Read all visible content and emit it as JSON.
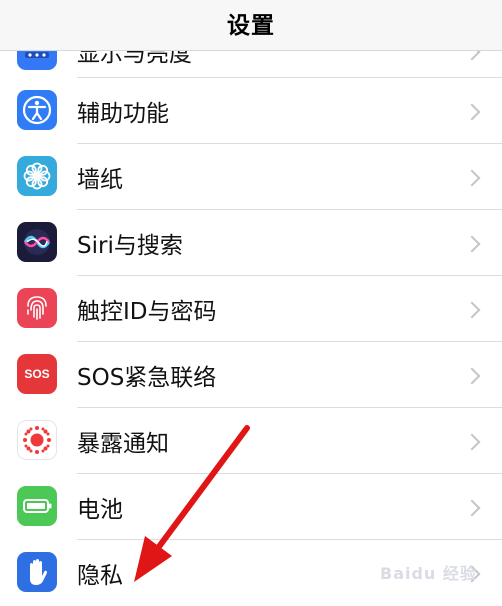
{
  "header": {
    "title": "设置"
  },
  "rows": [
    {
      "label": "显示与亮度",
      "icon": "home-screen-icon",
      "color": "#3478f6"
    },
    {
      "label": "辅助功能",
      "icon": "accessibility-icon",
      "color": "#2f7cf6"
    },
    {
      "label": "墙纸",
      "icon": "wallpaper-flower-icon",
      "color": "#35aadc"
    },
    {
      "label": "Siri与搜索",
      "icon": "siri-icon",
      "color": "#1b1b3a"
    },
    {
      "label": "触控ID与密码",
      "icon": "fingerprint-icon",
      "color": "#ea4456"
    },
    {
      "label": "SOS紧急联络",
      "icon": "sos-icon",
      "color": "#e5373a"
    },
    {
      "label": "暴露通知",
      "icon": "exposure-notification-icon",
      "color": "#ffffff"
    },
    {
      "label": "电池",
      "icon": "battery-icon",
      "color": "#4bc855"
    },
    {
      "label": "隐私",
      "icon": "privacy-hand-icon",
      "color": "#2f6fe4"
    }
  ],
  "sos_icon_text": "SOS",
  "watermark": "Baidu 经验"
}
